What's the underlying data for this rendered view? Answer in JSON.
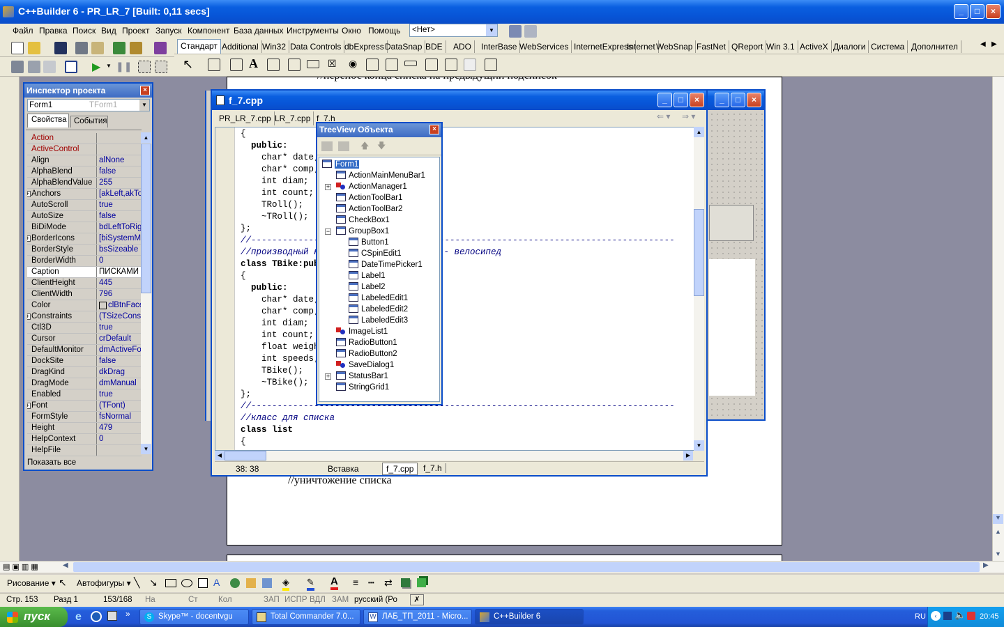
{
  "window": {
    "title": "C++Builder 6 - PR_LR_7 [Built: 0,11 secs]"
  },
  "menu": [
    "Файл",
    "Правка",
    "Поиск",
    "Вид",
    "Проект",
    "Запуск",
    "Компонент",
    "База данных",
    "Инструменты",
    "Окно",
    "Помощь"
  ],
  "config_select": "<Нет>",
  "palette_tabs": [
    "Стандарт",
    "Additional",
    "Win32",
    "Data Controls",
    "dbExpress",
    "DataSnap",
    "BDE",
    "ADO",
    "InterBase",
    "WebServices",
    "InternetExpress",
    "Internet",
    "WebSnap",
    "FastNet",
    "QReport",
    "Win 3.1",
    "ActiveX",
    "Диалоги",
    "Система",
    "Дополнител"
  ],
  "inspector": {
    "title": "Инспектор проекта",
    "object": "Form1",
    "object_type": "TForm1",
    "tabs": [
      "Свойства",
      "События"
    ],
    "footer": "Показать все",
    "props": [
      {
        "n": "Action",
        "v": "",
        "red": true
      },
      {
        "n": "ActiveControl",
        "v": "",
        "red": true
      },
      {
        "n": "Align",
        "v": "alNone"
      },
      {
        "n": "AlphaBlend",
        "v": "false"
      },
      {
        "n": "AlphaBlendValue",
        "v": "255"
      },
      {
        "n": "Anchors",
        "v": "[akLeft,akTo",
        "plus": true
      },
      {
        "n": "AutoScroll",
        "v": "true"
      },
      {
        "n": "AutoSize",
        "v": "false"
      },
      {
        "n": "BiDiMode",
        "v": "bdLeftToRig"
      },
      {
        "n": "BorderIcons",
        "v": "[biSystemMe",
        "plus": true
      },
      {
        "n": "BorderStyle",
        "v": "bsSizeable"
      },
      {
        "n": "BorderWidth",
        "v": "0"
      },
      {
        "n": "Caption",
        "v": "ПИСКАМИ",
        "selected": true
      },
      {
        "n": "ClientHeight",
        "v": "445"
      },
      {
        "n": "ClientWidth",
        "v": "796"
      },
      {
        "n": "Color",
        "v": "clBtnFace",
        "swatch": true
      },
      {
        "n": "Constraints",
        "v": "(TSizeConstr",
        "plus": true
      },
      {
        "n": "Ctl3D",
        "v": "true"
      },
      {
        "n": "Cursor",
        "v": "crDefault"
      },
      {
        "n": "DefaultMonitor",
        "v": "dmActiveFor"
      },
      {
        "n": "DockSite",
        "v": "false"
      },
      {
        "n": "DragKind",
        "v": "dkDrag"
      },
      {
        "n": "DragMode",
        "v": "dmManual"
      },
      {
        "n": "Enabled",
        "v": "true"
      },
      {
        "n": "Font",
        "v": "(TFont)",
        "plus": true
      },
      {
        "n": "FormStyle",
        "v": "fsNormal"
      },
      {
        "n": "Height",
        "v": "479"
      },
      {
        "n": "HelpContext",
        "v": "0"
      },
      {
        "n": "HelpFile",
        "v": ""
      }
    ]
  },
  "editor": {
    "title": "f_7.cpp",
    "tabs": [
      "PR_LR_7.cpp",
      "LR_7.cpp",
      "f_7.h"
    ],
    "status": {
      "pos": "38: 38",
      "mode": "Вставка",
      "tabs": [
        "f_7.cpp",
        "f_7.h"
      ]
    },
    "lines": [
      {
        "t": "{"
      },
      {
        "t": "  public:",
        "kw": true
      },
      {
        "t": "    char* date;"
      },
      {
        "t": "    char* comp;"
      },
      {
        "t": "    int diam;"
      },
      {
        "t": "    int count;"
      },
      {
        "t": "    TRoll();"
      },
      {
        "t": "    ~TRoll();"
      },
      {
        "t": "};"
      },
      {
        "t": "//---------------------------------------------------------------------------------",
        "c": true
      },
      {
        "t": "//производный к",
        "c": true,
        "tail": "иска - велосипед",
        "tailx": 290
      },
      {
        "t": "class TBike:pub",
        "kwc": true
      },
      {
        "t": "{"
      },
      {
        "t": "  public:",
        "kw": true
      },
      {
        "t": "    char* date;"
      },
      {
        "t": "    char* comp;"
      },
      {
        "t": "    int diam;"
      },
      {
        "t": "    int count;"
      },
      {
        "t": "    float weigh"
      },
      {
        "t": "    int speeds;",
        "tail": "ей",
        "tailx": 300
      },
      {
        "t": "    TBike();"
      },
      {
        "t": "    ~TBike();"
      },
      {
        "t": "};"
      },
      {
        "t": "//---------------------------------------------------------------------------------",
        "c": true
      },
      {
        "t": "//класс для списка",
        "c": true
      },
      {
        "t": "class list",
        "kwc": true
      },
      {
        "t": "{"
      }
    ]
  },
  "tree": {
    "title": "TreeView Объекта",
    "nodes": [
      {
        "t": "Form1",
        "lvl": 0,
        "sel": true
      },
      {
        "t": "ActionMainMenuBar1",
        "lvl": 1
      },
      {
        "t": "ActionManager1",
        "lvl": 1,
        "multi": true,
        "plus": true
      },
      {
        "t": "ActionToolBar1",
        "lvl": 1
      },
      {
        "t": "ActionToolBar2",
        "lvl": 1
      },
      {
        "t": "CheckBox1",
        "lvl": 1
      },
      {
        "t": "GroupBox1",
        "lvl": 1,
        "minus": true
      },
      {
        "t": "Button1",
        "lvl": 2
      },
      {
        "t": "CSpinEdit1",
        "lvl": 2
      },
      {
        "t": "DateTimePicker1",
        "lvl": 2
      },
      {
        "t": "Label1",
        "lvl": 2
      },
      {
        "t": "Label2",
        "lvl": 2
      },
      {
        "t": "LabeledEdit1",
        "lvl": 2
      },
      {
        "t": "LabeledEdit2",
        "lvl": 2
      },
      {
        "t": "LabeledEdit3",
        "lvl": 2
      },
      {
        "t": "ImageList1",
        "lvl": 1,
        "multi": true
      },
      {
        "t": "RadioButton1",
        "lvl": 1
      },
      {
        "t": "RadioButton2",
        "lvl": 1
      },
      {
        "t": "SaveDialog1",
        "lvl": 1,
        "multi": true
      },
      {
        "t": "StatusBar1",
        "lvl": 1,
        "plus": true
      },
      {
        "t": "StringGrid1",
        "lvl": 1
      }
    ]
  },
  "word": {
    "top_text": "//перенос конца списка на предыдущий подсписок",
    "bottom_text": "//уничтожение списка",
    "draw_label": "Рисование",
    "autoshapes": "Автофигуры",
    "status": [
      "Стр. 153",
      "Разд 1",
      "153/168",
      "На",
      "Ст",
      "Кол",
      "ЗАП",
      "ИСПР",
      "ВДЛ",
      "ЗАМ",
      "русский (Ро"
    ]
  },
  "taskbar": {
    "start": "пуск",
    "tasks": [
      "Skype™ - docentvgu",
      "Total Commander 7.0...",
      "ЛАБ_ТП_2011 - Micro...",
      "C++Builder 6"
    ],
    "lang": "RU",
    "clock": "20:45"
  }
}
